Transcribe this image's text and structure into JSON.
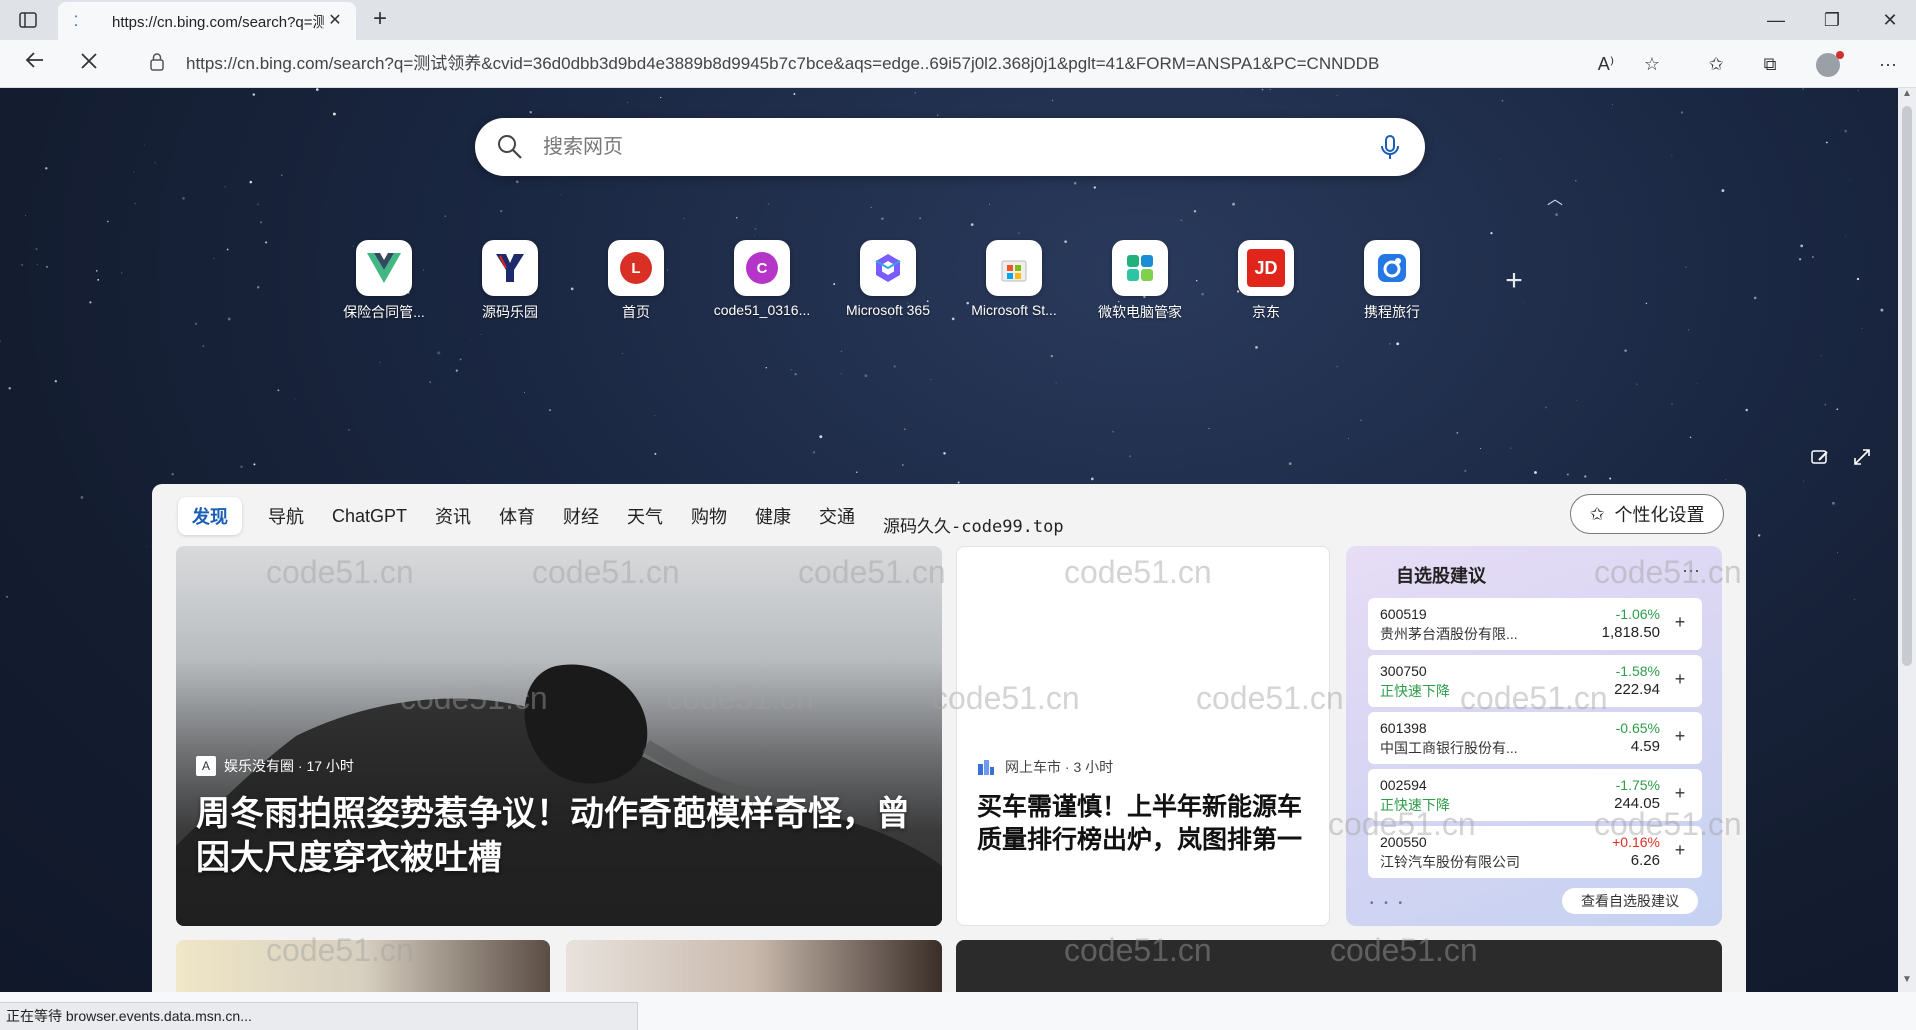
{
  "browser": {
    "tab_title": "https://cn.bing.com/search?q=测",
    "url": "https://cn.bing.com/search?q=测试领养&cvid=36d0dbb3d9bd4e3889b8d9945b7c7bce&aqs=edge..69i57j0l2.368j0j1&pglt=41&FORM=ANSPA1&PC=CNNDDB",
    "status_text": "正在等待 browser.events.data.msn.cn..."
  },
  "search": {
    "placeholder": "搜索网页"
  },
  "quick_links": [
    {
      "label": "保险合同管...",
      "icon": "vue-logo-icon",
      "color": "#41b883"
    },
    {
      "label": "源码乐园",
      "icon": "y-logo-icon",
      "color": "#1f2a6b"
    },
    {
      "label": "首页",
      "icon": "letter-l-icon",
      "letter": "L",
      "color": "#d93025"
    },
    {
      "label": "code51_0316...",
      "icon": "letter-c-icon",
      "letter": "C",
      "color": "#b535c9"
    },
    {
      "label": "Microsoft 365",
      "icon": "microsoft-365-icon",
      "color": "#7b5cff"
    },
    {
      "label": "Microsoft St...",
      "icon": "microsoft-store-icon",
      "color": "#7cbb3e"
    },
    {
      "label": "微软电脑管家",
      "icon": "pc-manager-icon",
      "color": "#22b07d"
    },
    {
      "label": "京东",
      "icon": "jd-logo-icon",
      "letter": "JD",
      "color": "#e1251b"
    },
    {
      "label": "携程旅行",
      "icon": "ctrip-logo-icon",
      "color": "#2577e3"
    }
  ],
  "feed": {
    "tabs": [
      "发现",
      "导航",
      "ChatGPT",
      "资讯",
      "体育",
      "财经",
      "天气",
      "购物",
      "健康",
      "交通"
    ],
    "promo": "源码久久-code99.top",
    "personalize_label": "个性化设置",
    "hero": {
      "source": "娱乐没有圈 · 17 小时",
      "title": "周冬雨拍照姿势惹争议！动作奇葩模样奇怪，曾因大尺度穿衣被吐槽"
    },
    "news2": {
      "source": "网上车市 · 3 小时",
      "title": "买车需谨慎！上半年新能源车质量排行榜出炉，岚图排第一"
    },
    "stocks": {
      "title": "自选股建议",
      "more": "···",
      "rows": [
        {
          "code": "600519",
          "name": "贵州茅台酒股份有限...",
          "change": "-1.06%",
          "price": "1,818.50",
          "dir": "down",
          "trend": false
        },
        {
          "code": "300750",
          "name": "正快速下降",
          "change": "-1.58%",
          "price": "222.94",
          "dir": "down",
          "trend": true
        },
        {
          "code": "601398",
          "name": "中国工商银行股份有...",
          "change": "-0.65%",
          "price": "4.59",
          "dir": "down",
          "trend": false
        },
        {
          "code": "002594",
          "name": "正快速下降",
          "change": "-1.75%",
          "price": "244.05",
          "dir": "down",
          "trend": true
        },
        {
          "code": "200550",
          "name": "江铃汽车股份有限公司",
          "change": "+0.16%",
          "price": "6.26",
          "dir": "up",
          "trend": false
        }
      ],
      "dots": "• • •",
      "link_label": "查看自选股建议"
    }
  },
  "watermark": "code51.cn"
}
